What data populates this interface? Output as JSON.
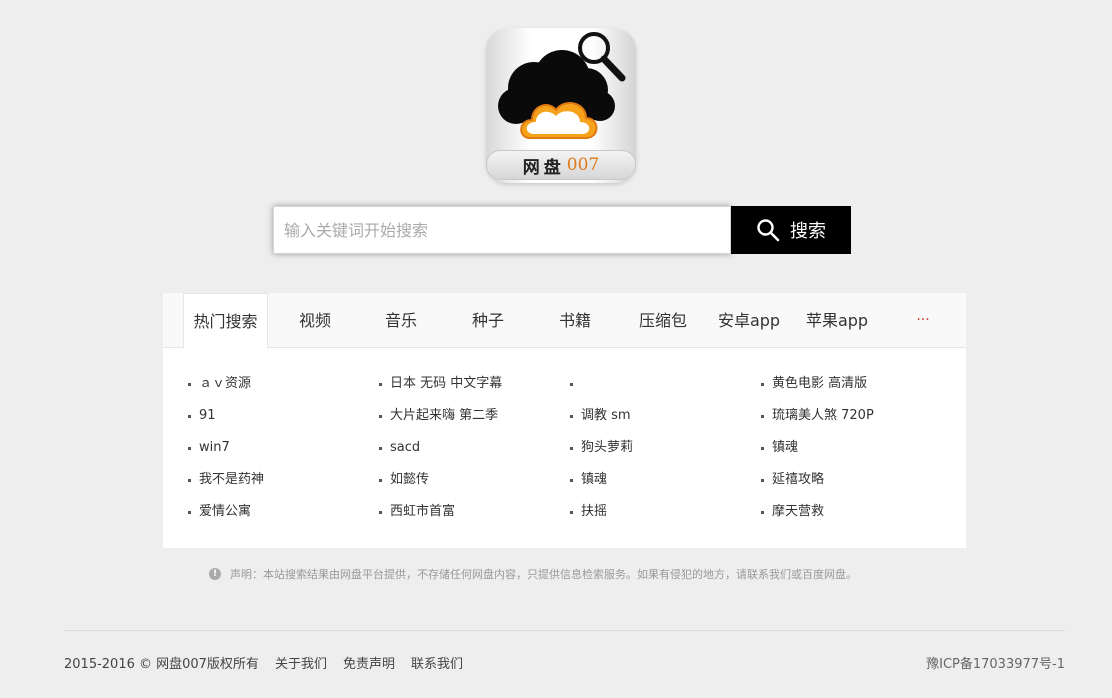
{
  "logo": {
    "name": "网盘",
    "number": "007"
  },
  "search": {
    "placeholder": "输入关键词开始搜索",
    "button_label": "搜索"
  },
  "tabs": [
    "热门搜索",
    "视频",
    "音乐",
    "种子",
    "书籍",
    "压缩包",
    "安卓app",
    "苹果app",
    "···"
  ],
  "active_tab": "热门搜索",
  "hot_columns": [
    [
      "ａｖ资源",
      "91",
      "win7",
      "我不是药神",
      "爱情公寓"
    ],
    [
      "日本 无码 中文字幕",
      "大片起来嗨 第二季",
      "sacd",
      "如懿传",
      "西虹市首富"
    ],
    [
      "",
      "调教 sm",
      "狗头萝莉",
      "镇魂",
      "扶摇"
    ],
    [
      "黄色电影 高清版",
      "琉璃美人煞 720P",
      "镇魂",
      "延禧攻略",
      "摩天营救"
    ]
  ],
  "notice": "声明：本站搜索结果由网盘平台提供，不存储任何网盘内容，只提供信息检索服务。如果有侵犯的地方，请联系我们或百度网盘。",
  "footer": {
    "copyright": "2015-2016 © 网盘007版权所有",
    "links": [
      "关于我们",
      "免责声明",
      "联系我们"
    ],
    "icp": "豫ICP备17033977号-1"
  }
}
